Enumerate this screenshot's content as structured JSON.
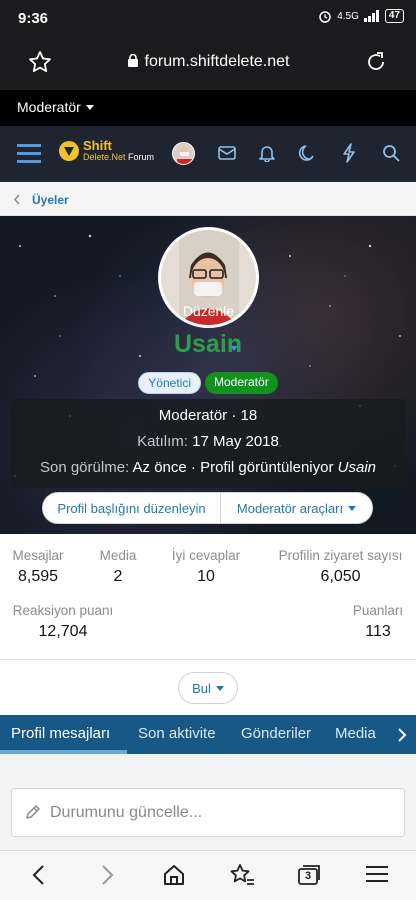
{
  "status_bar": {
    "time": "9:36",
    "network": "4.5G",
    "battery": "47"
  },
  "browser": {
    "url": "forum.shiftdelete.net"
  },
  "mod_bar": {
    "label": "Moderatör"
  },
  "site_nav": {
    "logo_line1": "Shift",
    "logo_line2": "Delete.Net",
    "logo_line3": "Forum"
  },
  "breadcrumb": {
    "label": "Üyeler"
  },
  "profile": {
    "avatar_edit": "Düzenle",
    "username": "Usain",
    "badges": [
      "Yönetici",
      "Moderatör"
    ],
    "title_line": "Moderatör · 18",
    "joined_label": "Katılım:",
    "joined_value": "17 May 2018",
    "last_seen_label": "Son görülme:",
    "last_seen_value": "Az önce · Profil görüntüleniyor",
    "last_seen_user": "Usain",
    "edit_banner_button": "Profil başlığını düzenleyin",
    "mod_tools_button": "Moderatör araçları"
  },
  "stats": [
    {
      "label": "Mesajlar",
      "value": "8,595"
    },
    {
      "label": "Media",
      "value": "2"
    },
    {
      "label": "İyi cevaplar",
      "value": "10"
    },
    {
      "label": "Profilin ziyaret sayısı",
      "value": "6,050"
    },
    {
      "label": "Reaksiyon puanı",
      "value": "12,704"
    },
    {
      "label": "Puanları",
      "value": "113"
    }
  ],
  "find_button": "Bul",
  "tabs": [
    {
      "label": "Profil mesajları",
      "active": true
    },
    {
      "label": "Son aktivite",
      "active": false
    },
    {
      "label": "Gönderiler",
      "active": false
    },
    {
      "label": "Media",
      "active": false
    }
  ],
  "status_input": {
    "placeholder": "Durumunu güncelle..."
  },
  "bottom_nav": {
    "tab_count": "3"
  },
  "colors": {
    "accent": "#185886",
    "link": "#2577b1",
    "username": "#2e9e4c",
    "mod_badge": "#12911f"
  }
}
